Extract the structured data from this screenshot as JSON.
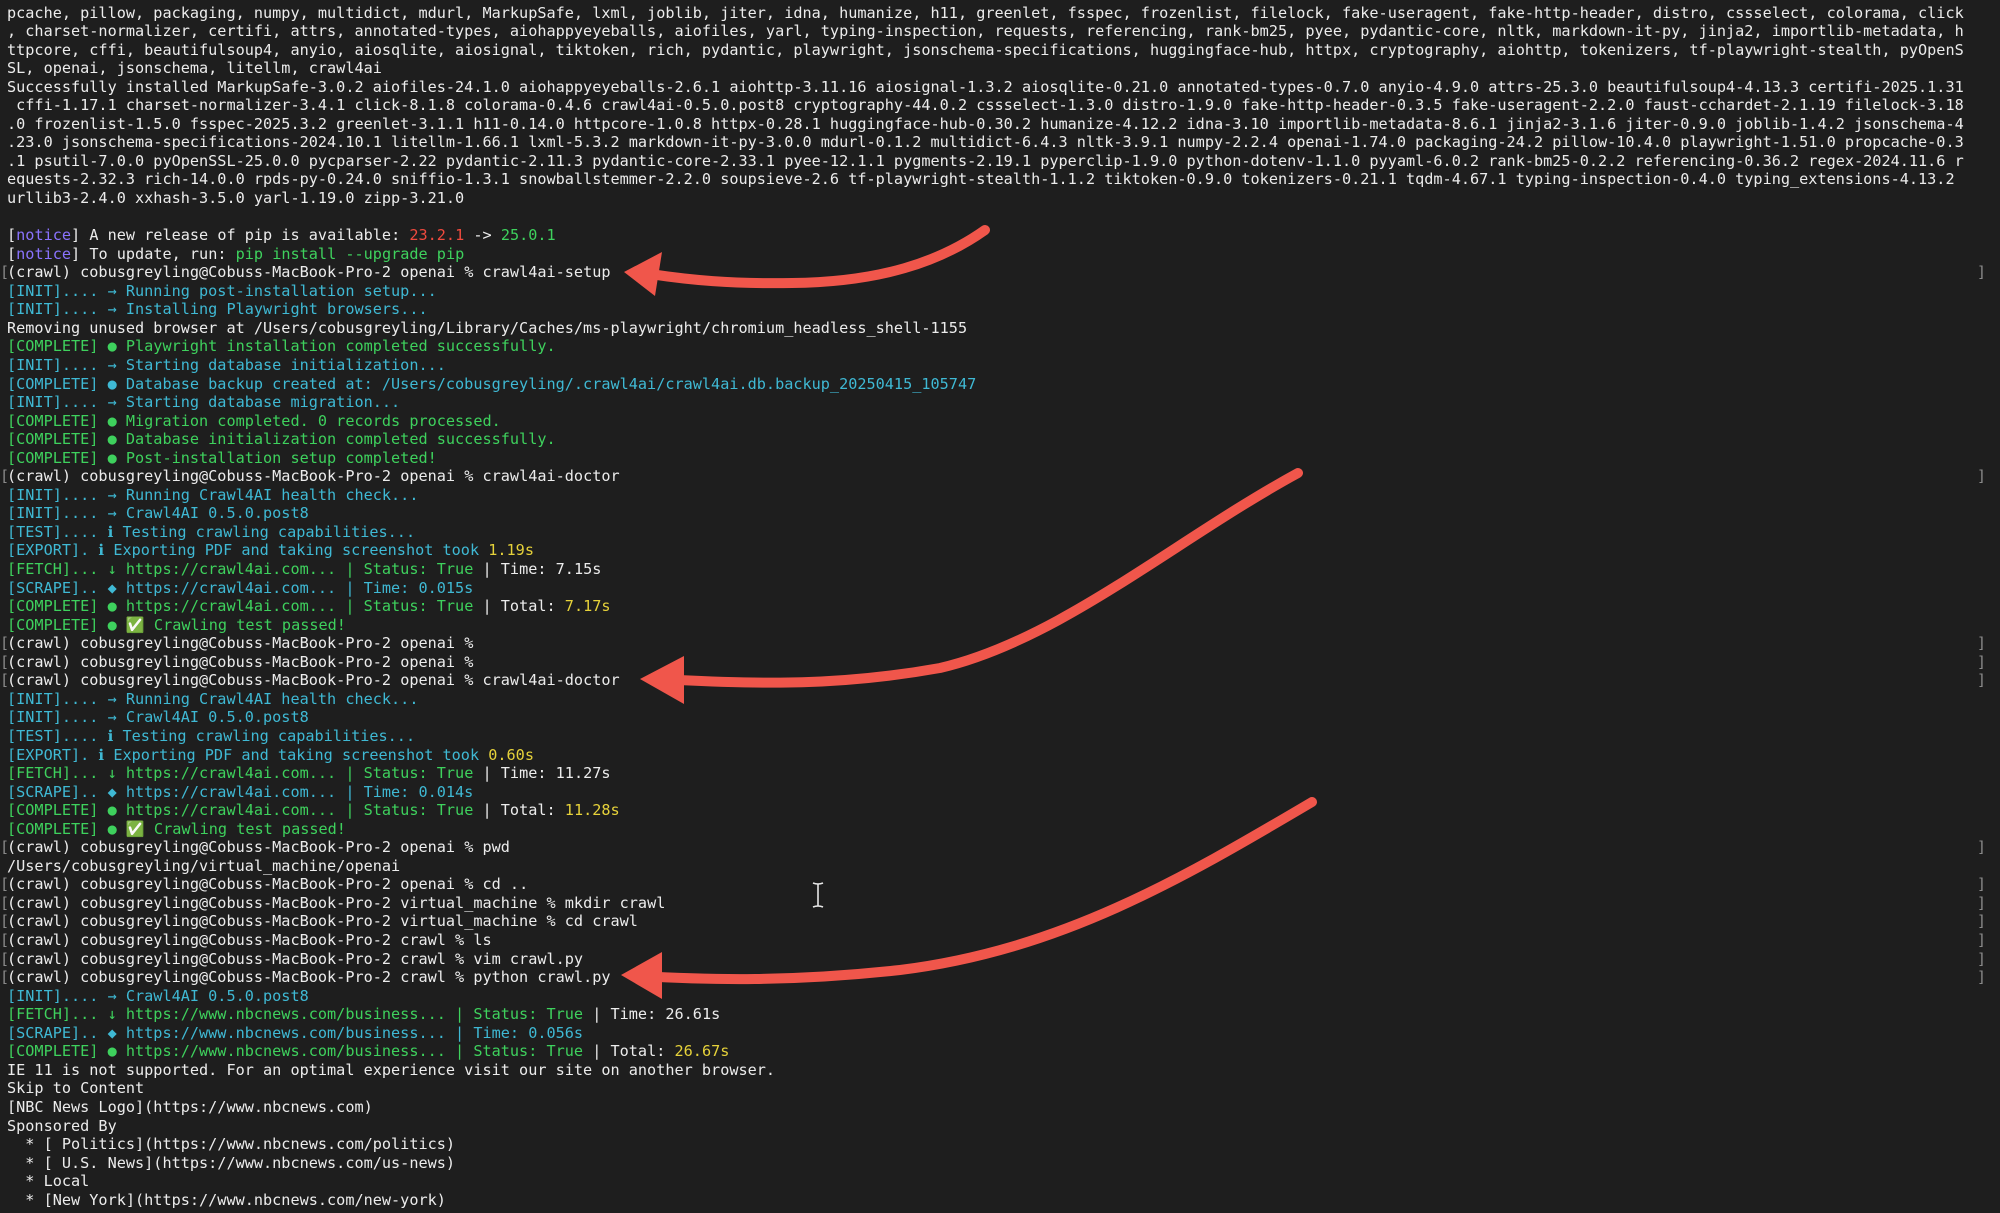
{
  "wrap_prefix": [
    "pcache, pillow, packaging, numpy, multidict, mdurl, MarkupSafe, lxml, joblib, jiter, idna, humanize, h11, greenlet, fsspec, frozenlist, filelock, fake-useragent, fake-http-header, distro, cssselect, colorama, click",
    ", charset-normalizer, certifi, attrs, annotated-types, aiohappyeyeballs, aiofiles, yarl, typing-inspection, requests, referencing, rank-bm25, pyee, pydantic-core, nltk, markdown-it-py, jinja2, importlib-metadata, h",
    "ttpcore, cffi, beautifulsoup4, anyio, aiosqlite, aiosignal, tiktoken, rich, pydantic, playwright, jsonschema-specifications, huggingface-hub, httpx, cryptography, aiohttp, tokenizers, tf-playwright-stealth, pyOpenS",
    "SL, openai, jsonschema, litellm, crawl4ai",
    "Successfully installed MarkupSafe-3.0.2 aiofiles-24.1.0 aiohappyeyeballs-2.6.1 aiohttp-3.11.16 aiosignal-1.3.2 aiosqlite-0.21.0 annotated-types-0.7.0 anyio-4.9.0 attrs-25.3.0 beautifulsoup4-4.13.3 certifi-2025.1.31",
    " cffi-1.17.1 charset-normalizer-3.4.1 click-8.1.8 colorama-0.4.6 crawl4ai-0.5.0.post8 cryptography-44.0.2 cssselect-1.3.0 distro-1.9.0 fake-http-header-0.3.5 fake-useragent-2.2.0 faust-cchardet-2.1.19 filelock-3.18",
    ".0 frozenlist-1.5.0 fsspec-2025.3.2 greenlet-3.1.1 h11-0.14.0 httpcore-1.0.8 httpx-0.28.1 huggingface-hub-0.30.2 humanize-4.12.2 idna-3.10 importlib-metadata-8.6.1 jinja2-3.1.6 jiter-0.9.0 joblib-1.4.2 jsonschema-4",
    ".23.0 jsonschema-specifications-2024.10.1 litellm-1.66.1 lxml-5.3.2 markdown-it-py-3.0.0 mdurl-0.1.2 multidict-6.4.3 nltk-3.9.1 numpy-2.2.4 openai-1.74.0 packaging-24.2 pillow-10.4.0 playwright-1.51.0 propcache-0.3",
    ".1 psutil-7.0.0 pyOpenSSL-25.0.0 pycparser-2.22 pydantic-2.11.3 pydantic-core-2.33.1 pyee-12.1.1 pygments-2.19.1 pyperclip-1.9.0 python-dotenv-1.1.0 pyyaml-6.0.2 rank-bm25-0.2.2 referencing-0.36.2 regex-2024.11.6 r",
    "equests-2.32.3 rich-14.0.0 rpds-py-0.24.0 sniffio-1.3.1 snowballstemmer-2.2.0 soupsieve-2.6 tf-playwright-stealth-1.1.2 tiktoken-0.9.0 tokenizers-0.21.1 tqdm-4.67.1 typing-inspection-0.4.0 typing_extensions-4.13.2",
    "urllib3-2.4.0 xxhash-3.5.0 yarl-1.19.0 zipp-3.21.0"
  ],
  "pip_notice": {
    "tag": "notice",
    "release_text": " A new release of pip is available: ",
    "old_version": "23.2.1",
    "arrow": " -> ",
    "new_version": "25.0.1",
    "update_text": " To update, run: ",
    "update_cmd": "pip install --upgrade pip"
  },
  "prompt": "(crawl) cobusgreyling@Cobuss-MacBook-Pro-2 ",
  "session": [
    {
      "type": "cmd",
      "dir": "openai",
      "cmd": "crawl4ai-setup"
    },
    {
      "type": "log",
      "color": "cyan",
      "text": "[INIT].... → Running post-installation setup..."
    },
    {
      "type": "log",
      "color": "cyan",
      "text": "[INIT].... → Installing Playwright browsers..."
    },
    {
      "type": "log",
      "color": "white",
      "text": "Removing unused browser at /Users/cobusgreyling/Library/Caches/ms-playwright/chromium_headless_shell-1155"
    },
    {
      "type": "log",
      "color": "green",
      "text": "[COMPLETE] ● Playwright installation completed successfully."
    },
    {
      "type": "log",
      "color": "cyan",
      "text": "[INIT].... → Starting database initialization..."
    },
    {
      "type": "log",
      "color": "cyan",
      "text": "[COMPLETE] ● Database backup created at: /Users/cobusgreyling/.crawl4ai/crawl4ai.db.backup_20250415_105747"
    },
    {
      "type": "log",
      "color": "cyan",
      "text": "[INIT].... → Starting database migration..."
    },
    {
      "type": "log",
      "color": "green",
      "text": "[COMPLETE] ● Migration completed. 0 records processed."
    },
    {
      "type": "log",
      "color": "green",
      "text": "[COMPLETE] ● Database initialization completed successfully."
    },
    {
      "type": "log",
      "color": "green",
      "text": "[COMPLETE] ● Post-installation setup completed!"
    },
    {
      "type": "cmd",
      "dir": "openai",
      "cmd": "crawl4ai-doctor"
    },
    {
      "type": "log",
      "color": "cyan",
      "text": "[INIT].... → Running Crawl4AI health check..."
    },
    {
      "type": "log",
      "color": "cyan",
      "text": "[INIT].... → Crawl4AI 0.5.0.post8"
    },
    {
      "type": "log",
      "color": "cyan",
      "text": "[TEST].... ℹ Testing crawling capabilities..."
    },
    {
      "type": "export",
      "pre": "[EXPORT]. ℹ Exporting PDF and taking screenshot took ",
      "val": "1.19s"
    },
    {
      "type": "status",
      "color": "green",
      "prefix": "[FETCH]... ↓ https://crawl4ai.com... | Status: ",
      "flag": "True",
      "sep": " | ",
      "label": "Time: ",
      "val": "7.15s",
      "valcolor": "white"
    },
    {
      "type": "status",
      "color": "cyan",
      "prefix": "[SCRAPE].. ◆ https://crawl4ai.com... | Time: ",
      "flag": "",
      "sep": "",
      "label": "",
      "val": "0.015s",
      "valcolor": "cyan"
    },
    {
      "type": "status",
      "color": "green",
      "prefix": "[COMPLETE] ● https://crawl4ai.com... | Status: ",
      "flag": "True",
      "sep": " | ",
      "label": "Total: ",
      "val": "7.17s",
      "valcolor": "yellow"
    },
    {
      "type": "log",
      "color": "green",
      "text": "[COMPLETE] ● ✅ Crawling test passed!"
    },
    {
      "type": "cmd",
      "dir": "openai",
      "cmd": ""
    },
    {
      "type": "cmd",
      "dir": "openai",
      "cmd": ""
    },
    {
      "type": "cmd",
      "dir": "openai",
      "cmd": "crawl4ai-doctor"
    },
    {
      "type": "log",
      "color": "cyan",
      "text": "[INIT].... → Running Crawl4AI health check..."
    },
    {
      "type": "log",
      "color": "cyan",
      "text": "[INIT].... → Crawl4AI 0.5.0.post8"
    },
    {
      "type": "log",
      "color": "cyan",
      "text": "[TEST].... ℹ Testing crawling capabilities..."
    },
    {
      "type": "export",
      "pre": "[EXPORT]. ℹ Exporting PDF and taking screenshot took ",
      "val": "0.60s"
    },
    {
      "type": "status",
      "color": "green",
      "prefix": "[FETCH]... ↓ https://crawl4ai.com... | Status: ",
      "flag": "True",
      "sep": " | ",
      "label": "Time: ",
      "val": "11.27s",
      "valcolor": "white"
    },
    {
      "type": "status",
      "color": "cyan",
      "prefix": "[SCRAPE].. ◆ https://crawl4ai.com... | Time: ",
      "flag": "",
      "sep": "",
      "label": "",
      "val": "0.014s",
      "valcolor": "cyan"
    },
    {
      "type": "status",
      "color": "green",
      "prefix": "[COMPLETE] ● https://crawl4ai.com... | Status: ",
      "flag": "True",
      "sep": " | ",
      "label": "Total: ",
      "val": "11.28s",
      "valcolor": "yellow"
    },
    {
      "type": "log",
      "color": "green",
      "text": "[COMPLETE] ● ✅ Crawling test passed!"
    },
    {
      "type": "cmd",
      "dir": "openai",
      "cmd": "pwd"
    },
    {
      "type": "log",
      "color": "white",
      "text": "/Users/cobusgreyling/virtual_machine/openai"
    },
    {
      "type": "cmd",
      "dir": "openai",
      "cmd": "cd .."
    },
    {
      "type": "cmd",
      "dir": "virtual_machine",
      "cmd": "mkdir crawl"
    },
    {
      "type": "cmd",
      "dir": "virtual_machine",
      "cmd": "cd crawl"
    },
    {
      "type": "cmd",
      "dir": "crawl",
      "cmd": "ls"
    },
    {
      "type": "cmd",
      "dir": "crawl",
      "cmd": "vim crawl.py"
    },
    {
      "type": "cmd",
      "dir": "crawl",
      "cmd": "python crawl.py"
    },
    {
      "type": "log",
      "color": "cyan",
      "text": "[INIT].... → Crawl4AI 0.5.0.post8"
    },
    {
      "type": "status",
      "color": "green",
      "prefix": "[FETCH]... ↓ https://www.nbcnews.com/business... | Status: ",
      "flag": "True",
      "sep": " | ",
      "label": "Time: ",
      "val": "26.61s",
      "valcolor": "white"
    },
    {
      "type": "status",
      "color": "cyan",
      "prefix": "[SCRAPE].. ◆ https://www.nbcnews.com/business... | Time: ",
      "flag": "",
      "sep": "",
      "label": "",
      "val": "0.056s",
      "valcolor": "cyan"
    },
    {
      "type": "status",
      "color": "green",
      "prefix": "[COMPLETE] ● https://www.nbcnews.com/business... | Status: ",
      "flag": "True",
      "sep": " | ",
      "label": "Total: ",
      "val": "26.67s",
      "valcolor": "yellow"
    },
    {
      "type": "log",
      "color": "white",
      "text": "IE 11 is not supported. For an optimal experience visit our site on another browser."
    },
    {
      "type": "log",
      "color": "white",
      "text": "Skip to Content"
    },
    {
      "type": "log",
      "color": "white",
      "text": "[NBC News Logo](https://www.nbcnews.com)"
    },
    {
      "type": "log",
      "color": "white",
      "text": "Sponsored By"
    },
    {
      "type": "log",
      "color": "white",
      "text": "  * [ Politics](https://www.nbcnews.com/politics)"
    },
    {
      "type": "log",
      "color": "white",
      "text": "  * [ U.S. News](https://www.nbcnews.com/us-news)"
    },
    {
      "type": "log",
      "color": "white",
      "text": "  * Local"
    },
    {
      "type": "log",
      "color": "white",
      "text": "  * [New York](https://www.nbcnews.com/new-york)"
    }
  ],
  "colors": {
    "background": "#1e1e1e",
    "text": "#ececec",
    "cyan": "#3fb9d4",
    "green": "#3ed15d",
    "yellow": "#e6d23a",
    "red": "#ef4a3e",
    "purple": "#8a73ff",
    "annotation_arrow": "#f0564b"
  },
  "annotations": [
    "red-arrow-icon",
    "red-arrow-icon",
    "red-arrow-icon"
  ],
  "cursor": "i-beam-cursor-icon"
}
